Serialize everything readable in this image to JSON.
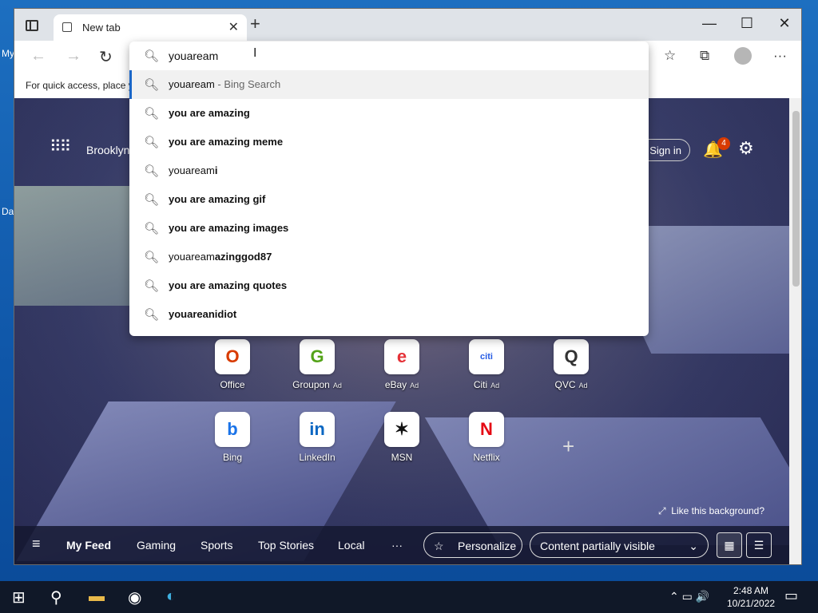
{
  "desktop": {
    "label_1": "My",
    "label_2": "Da"
  },
  "browser": {
    "tab_title": "New tab",
    "favorites_bar_text": "For quick access, place y",
    "address_value": "youaream"
  },
  "suggestions": {
    "items": [
      {
        "plain": "youaream",
        "bold": "",
        "suffix": " - Bing Search"
      },
      {
        "plain": "",
        "bold": "you are amazing",
        "suffix": ""
      },
      {
        "plain": "",
        "bold": "you are amazing meme",
        "suffix": ""
      },
      {
        "plain": "youaream",
        "bold": "i",
        "suffix": ""
      },
      {
        "plain": "",
        "bold": "you are amazing gif",
        "suffix": ""
      },
      {
        "plain": "",
        "bold": "you are amazing images",
        "suffix": ""
      },
      {
        "plain": "youaream",
        "bold": "azinggod87",
        "suffix": ""
      },
      {
        "plain": "",
        "bold": "you are amazing quotes",
        "suffix": ""
      },
      {
        "plain": "",
        "bold": "youareanidiot",
        "suffix": ""
      }
    ]
  },
  "page": {
    "location": "Brooklyn",
    "sign_in": "Sign in",
    "notification_count": "4",
    "like_background": "Like this background?",
    "tiles": [
      {
        "label": "Office",
        "ad": "",
        "glyph": "O",
        "color": "#d83b01"
      },
      {
        "label": "Groupon",
        "ad": "Ad",
        "glyph": "G",
        "color": "#53a318"
      },
      {
        "label": "eBay",
        "ad": "Ad",
        "glyph": "e",
        "color": "#e53238"
      },
      {
        "label": "Citi",
        "ad": "Ad",
        "glyph": "citi",
        "color": "#255be3"
      },
      {
        "label": "QVC",
        "ad": "Ad",
        "glyph": "Q",
        "color": "#333333"
      },
      {
        "label": "Bing",
        "ad": "",
        "glyph": "b",
        "color": "#1a73e8"
      },
      {
        "label": "LinkedIn",
        "ad": "",
        "glyph": "in",
        "color": "#0a66c2"
      },
      {
        "label": "MSN",
        "ad": "",
        "glyph": "✶",
        "color": "#111111"
      },
      {
        "label": "Netflix",
        "ad": "",
        "glyph": "N",
        "color": "#e50914"
      }
    ],
    "feed": {
      "tabs": [
        "My Feed",
        "Gaming",
        "Sports",
        "Top Stories",
        "Local"
      ],
      "more": "···",
      "personalize": "Personalize",
      "content_select": "Content partially visible"
    }
  },
  "taskbar": {
    "time": "2:48 AM",
    "date": "10/21/2022"
  }
}
